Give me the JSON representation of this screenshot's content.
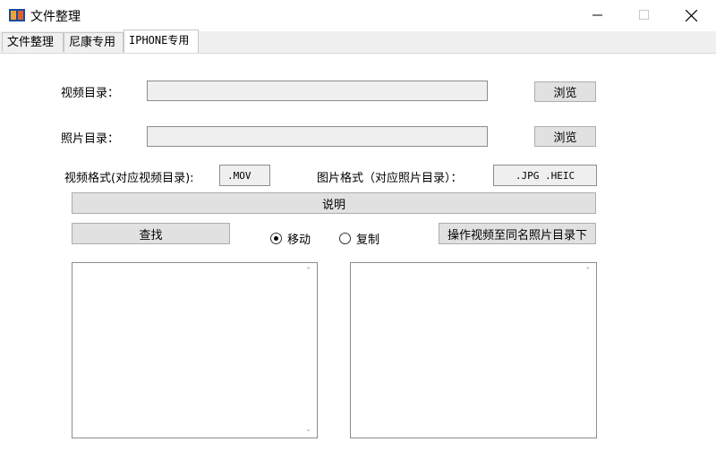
{
  "window": {
    "title": "文件整理",
    "minimize_icon": "minimize-icon",
    "maximize_icon": "maximize-icon",
    "close_icon": "close-icon"
  },
  "tabs": [
    {
      "label": "文件整理"
    },
    {
      "label": "尼康专用"
    },
    {
      "label": "IPHONE专用",
      "active": true
    }
  ],
  "form": {
    "video_dir_label": "视频目录：",
    "video_dir_value": "",
    "photo_dir_label": "照片目录：",
    "photo_dir_value": "",
    "browse_label": "浏览",
    "video_format_label": "视频格式(对应视频目录):",
    "video_format_value": ".MOV",
    "photo_format_label": "图片格式（对应照片目录）：",
    "photo_format_value": ".JPG .HEIC",
    "explain_label": "说明",
    "find_label": "查找",
    "radio_move": "移动",
    "radio_copy": "复制",
    "selected_mode": "移动",
    "operate_label": "操作视频至同名照片目录下"
  },
  "colors": {
    "button_bg": "#e1e1e1",
    "field_bg": "#efefef",
    "border": "#8c8c8c"
  }
}
